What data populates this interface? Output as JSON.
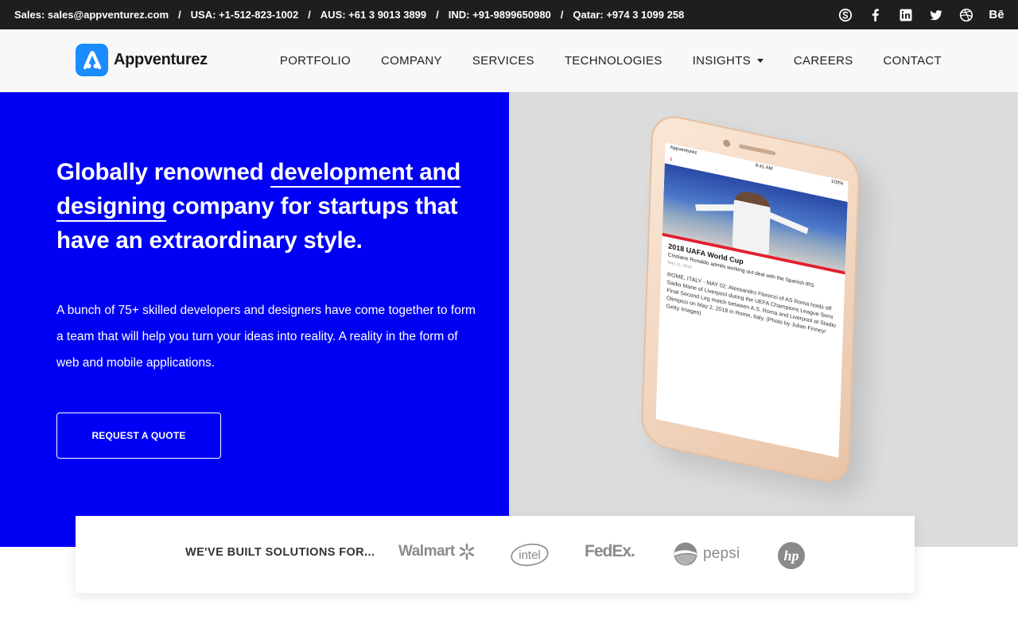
{
  "topbar": {
    "contacts": [
      {
        "label": "Sales: sales@appventurez.com"
      },
      {
        "label": "USA: +1-512-823-1002"
      },
      {
        "label": "AUS: +61 3 9013 3899"
      },
      {
        "label": "IND: +91-9899650980"
      },
      {
        "label": "Qatar: +974 3 1099 258"
      }
    ],
    "separator": "/",
    "social_icons": [
      "skype-icon",
      "facebook-icon",
      "linkedin-icon",
      "twitter-icon",
      "dribbble-icon",
      "behance-icon"
    ],
    "behance_text": "Bē"
  },
  "header": {
    "logo_text": "Appventurez",
    "nav": [
      {
        "label": "PORTFOLIO"
      },
      {
        "label": "COMPANY"
      },
      {
        "label": "SERVICES"
      },
      {
        "label": "TECHNOLOGIES"
      },
      {
        "label": "INSIGHTS",
        "has_dropdown": true
      },
      {
        "label": "CAREERS"
      },
      {
        "label": "CONTACT"
      }
    ]
  },
  "hero": {
    "title_part1": "Globally renowned ",
    "title_underlined1": "development and",
    "title_underlined2": "designing",
    "title_part2": " company for startups that have an extraordinary style.",
    "description": "A bunch of 75+ skilled developers and designers have come together to form a team that will help you turn your ideas into reality. A reality in the form of web and mobile applications.",
    "cta_label": "REQUEST A QUOTE",
    "colors": {
      "left_bg": "#0000f5",
      "right_bg": "#dcdcdc",
      "text": "#ffffff"
    }
  },
  "phone": {
    "status_left": "Appventurez",
    "status_time": "9:41 AM",
    "status_right": "100%",
    "article_title": "2018 UAFA World Cup",
    "article_subtitle": "Cristiano Ronaldo admits working out deal with the Spanish IRS",
    "article_date": "May 21, 2018",
    "article_body": "ROME, ITALY - MAY 02: Alessandro Florenzi of AS Roma holds off Sadio Mane of Liverpool during the UEFA Champions League Semi Final Second Leg match between A.S. Roma and Liverpool at Stadio Olimpico on May 2, 2018 in Rome, Italy. (Photo by Julian Finney/ Getty Images)"
  },
  "clients": {
    "label": "WE'VE BUILT SOLUTIONS FOR...",
    "logos": [
      {
        "name": "walmart-logo",
        "text": "Walmart"
      },
      {
        "name": "intel-logo",
        "text": "intel"
      },
      {
        "name": "fedex-logo",
        "text": "FedEx."
      },
      {
        "name": "pepsi-logo",
        "text": "pepsi"
      },
      {
        "name": "hp-logo",
        "text": "hp"
      }
    ]
  }
}
